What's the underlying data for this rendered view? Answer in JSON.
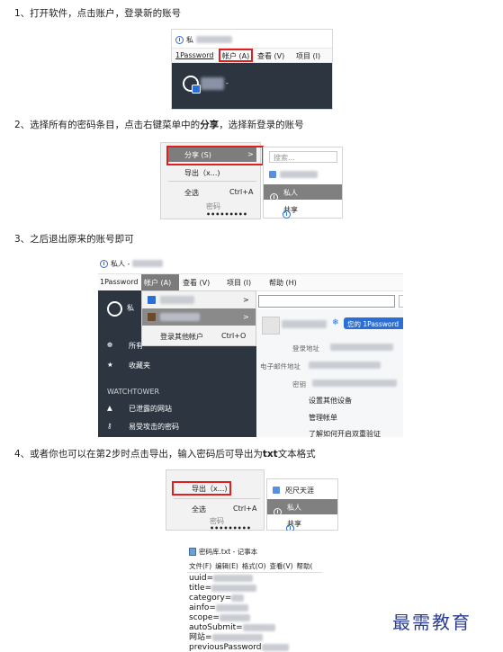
{
  "steps": {
    "s1": "1、打开软件，点击账户，登录新的账号",
    "s2_pre": "2、选择所有的密码条目，点击右键菜单中的",
    "s2_bold": "分享",
    "s2_post": "，选择新登录的账号",
    "s3": "3、之后退出原来的账号即可",
    "s4_pre": "4、或者你也可以在第2步时点击导出，输入密码后可导出为",
    "s4_bold": "txt",
    "s4_post": "文本格式"
  },
  "shot1": {
    "title_prefix": "私",
    "menu": [
      "1Password",
      "帐户 (A)",
      "查看 (V)",
      "项目 (I)"
    ],
    "dash": "-"
  },
  "shot2": {
    "share": "分享 (S)",
    "share_arrow": ">",
    "export": "导出（x...)",
    "select_all": "全选",
    "select_all_key": "Ctrl+A",
    "field": "密码",
    "dots": "•••••••••",
    "search": "搜索...",
    "vault_private": "私人",
    "vault_shared": "共享"
  },
  "shot3": {
    "title": "私人 -",
    "menu": [
      "1Password",
      "帐户 (A)",
      "查看 (V)",
      "项目 (I)",
      "帮助 (H)"
    ],
    "login_other": "登录其他帐户",
    "login_other_key": "Ctrl+O",
    "sidebar_all": "所有",
    "sidebar_fav": "收藏夹",
    "section": "WATCHTOWER",
    "sidebar_exposed": "已泄露的网站",
    "sidebar_vuln": "易受攻击的密码",
    "your_1password": "您的 1Password",
    "label_login": "登录地址",
    "label_email": "电子邮件地址",
    "label_secret": "密钥",
    "link_setup": "设置其他设备",
    "link_manage": "管理帐单",
    "link_2fa": "了解如何开启双重验证",
    "arrow": ">",
    "private_prefix": "私"
  },
  "shot4": {
    "export": "导出（x...)",
    "select_all": "全选",
    "select_all_key": "Ctrl+A",
    "field": "密码",
    "dots": "•••••••••",
    "vault_other": "咫尺天涯",
    "vault_private": "私人",
    "vault_shared": "共享"
  },
  "notepad": {
    "title": "密码库.txt - 记事本",
    "menu": [
      "文件(F)",
      "编辑(E)",
      "格式(O)",
      "查看(V)",
      "帮助("
    ],
    "lines": [
      "uuid=",
      "title=",
      "category=",
      "ainfo=",
      "scope=",
      "autoSubmit=",
      "网站=",
      "previousPassword"
    ]
  },
  "watermark": "最需教育",
  "colors": {
    "highlight": "#e02020",
    "brand_blue": "#2a6fd6",
    "dark_sidebar": "#2c3540",
    "menu_selected": "#808080"
  }
}
